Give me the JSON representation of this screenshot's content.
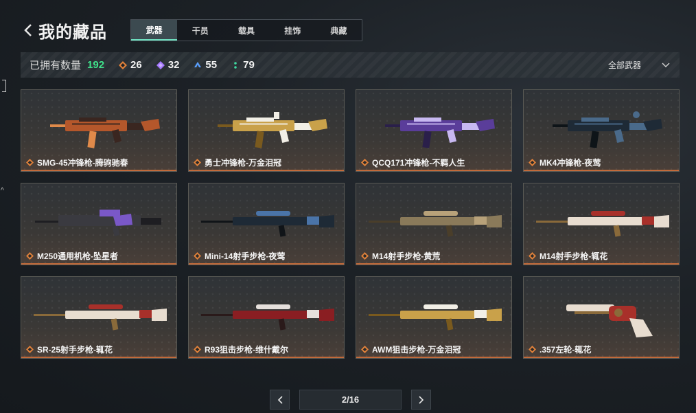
{
  "header": {
    "title": "我的藏品"
  },
  "tabs": [
    {
      "label": "武器",
      "active": true
    },
    {
      "label": "干员",
      "active": false
    },
    {
      "label": "载具",
      "active": false
    },
    {
      "label": "挂饰",
      "active": false
    },
    {
      "label": "典藏",
      "active": false
    }
  ],
  "stats": {
    "label": "已拥有数量",
    "total": "192",
    "rarities": [
      {
        "icon": "orange-diamond-icon",
        "color": "#e0813a",
        "count": "26"
      },
      {
        "icon": "purple-diamond-icon",
        "color": "#a678ff",
        "count": "32"
      },
      {
        "icon": "blue-chevron-icon",
        "color": "#5aa0ff",
        "count": "55"
      },
      {
        "icon": "green-dots-icon",
        "color": "#3fd8a0",
        "count": "79"
      }
    ],
    "filter": "全部武器"
  },
  "items": [
    {
      "name": "SMG-45冲锋枪-腾驹驰春",
      "gun": "smg",
      "palette": [
        "#b5572b",
        "#3a2620",
        "#e08a4a"
      ]
    },
    {
      "name": "勇士冲锋枪-万金泪冠",
      "gun": "smg2",
      "palette": [
        "#c9a14a",
        "#f2efe6",
        "#7a5a1e"
      ]
    },
    {
      "name": "QCQ171冲锋枪-不羁人生",
      "gun": "smg3",
      "palette": [
        "#5a3d9a",
        "#c7b8f0",
        "#2a1f4a"
      ]
    },
    {
      "name": "MK4冲锋枪-夜莺",
      "gun": "smg4",
      "palette": [
        "#1e2a36",
        "#4a6a8a",
        "#0e1418"
      ]
    },
    {
      "name": "M250通用机枪-坠星者",
      "gun": "lmg",
      "palette": [
        "#3a3a40",
        "#7a58c8",
        "#1e1e22"
      ]
    },
    {
      "name": "Mini-14射手步枪-夜莺",
      "gun": "rifle",
      "palette": [
        "#1e2a36",
        "#4a74a8",
        "#101418"
      ]
    },
    {
      "name": "M14射手步枪-黄荒",
      "gun": "rifle2",
      "palette": [
        "#8a7a5a",
        "#b8a27a",
        "#4a3e2a"
      ]
    },
    {
      "name": "M14射手步枪-辄花",
      "gun": "rifle3",
      "palette": [
        "#e8ddd0",
        "#a8302a",
        "#8a6a3a"
      ]
    },
    {
      "name": "SR-25射手步枪-辄花",
      "gun": "sniper",
      "palette": [
        "#e8ddd0",
        "#a8302a",
        "#8a6a3a"
      ]
    },
    {
      "name": "R93狙击步枪-维什戴尔",
      "gun": "sniper2",
      "palette": [
        "#8a1e22",
        "#e6e0dc",
        "#2a1a1a"
      ]
    },
    {
      "name": "AWM狙击步枪-万金泪冠",
      "gun": "sniper3",
      "palette": [
        "#c9a14a",
        "#f2efe6",
        "#7a5a1e"
      ]
    },
    {
      "name": ".357左轮-辄花",
      "gun": "revolver",
      "palette": [
        "#e8ddd0",
        "#a8302a",
        "#8a6a3a"
      ]
    }
  ],
  "pager": {
    "text": "2/16"
  }
}
